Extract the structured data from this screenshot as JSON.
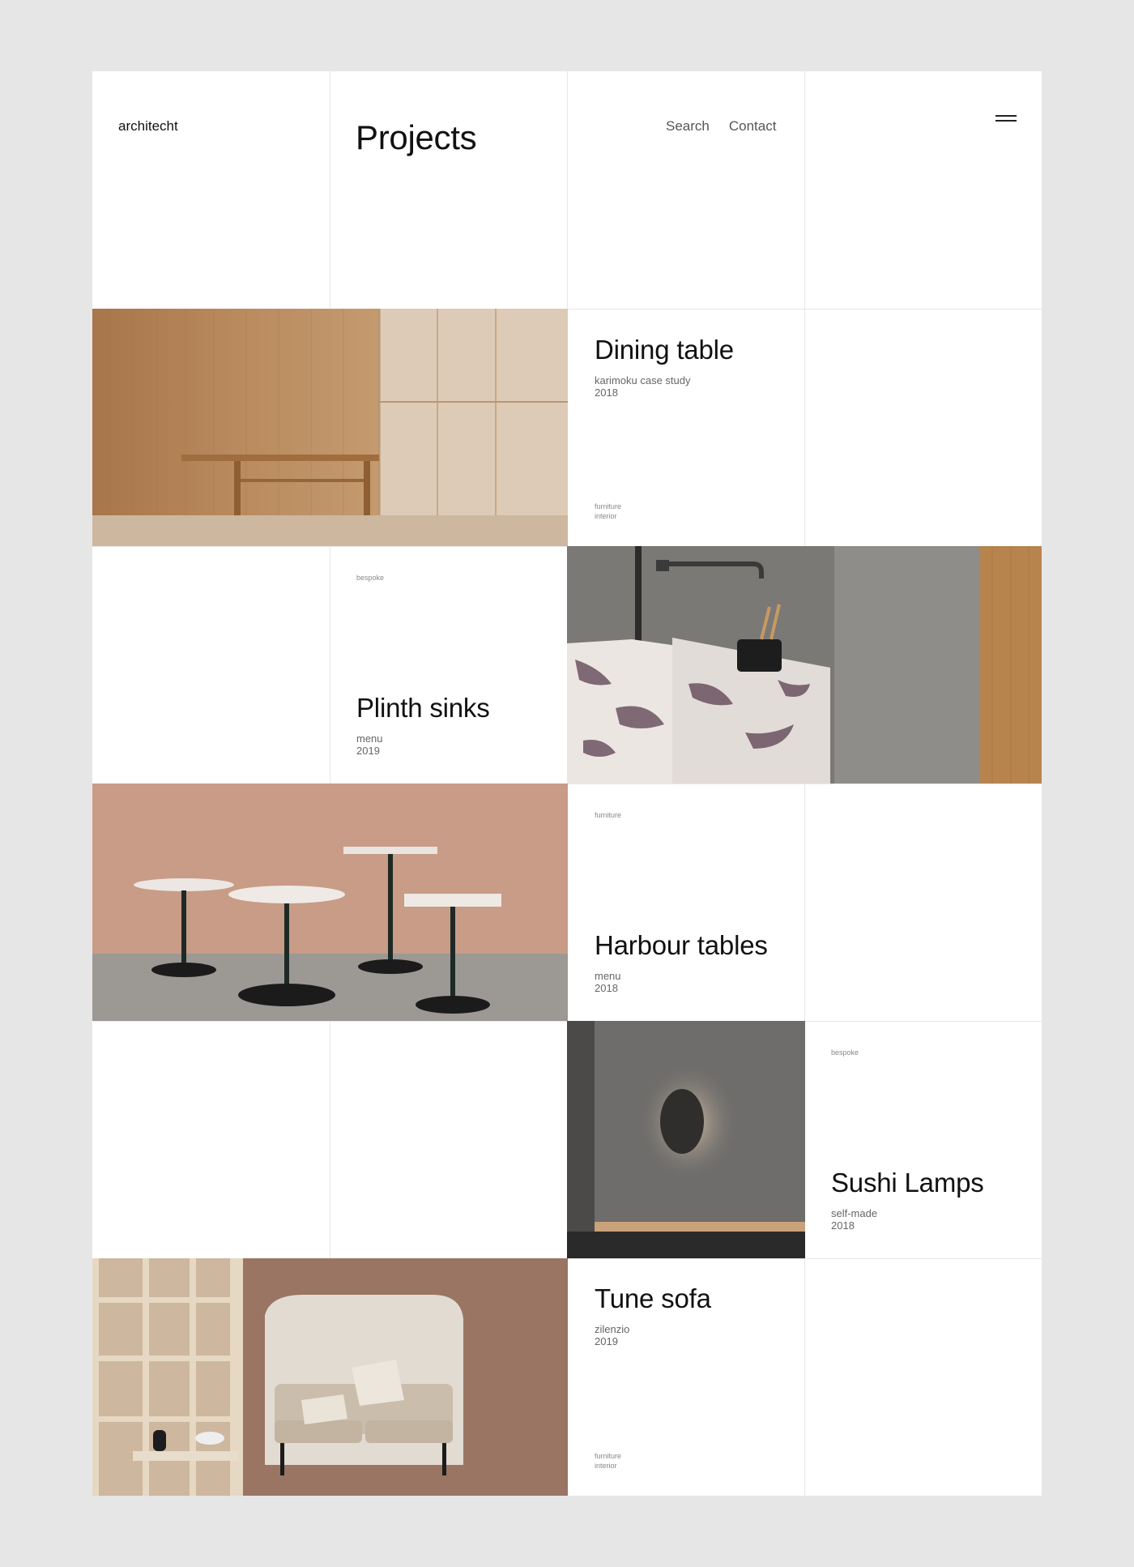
{
  "header": {
    "logo": "architecht",
    "title": "Projects",
    "nav": {
      "search": "Search",
      "contact": "Contact"
    },
    "menu_icon": "hamburger-menu-icon"
  },
  "projects": [
    {
      "title": "Dining table",
      "meta1": "karimoku case study",
      "year": "2018",
      "tag1": "furniture",
      "tag2": "interior"
    },
    {
      "title": "Plinth sinks",
      "meta1": "menu",
      "year": "2019",
      "tag1": "bespoke"
    },
    {
      "title": "Harbour tables",
      "meta1": "menu",
      "year": "2018",
      "tag1": "furniture"
    },
    {
      "title": "Sushi Lamps",
      "meta1": "self-made",
      "year": "2018",
      "tag1": "bespoke"
    },
    {
      "title": "Tune sofa",
      "meta1": "zilenzio",
      "year": "2019",
      "tag1": "furniture",
      "tag2": "interior"
    }
  ],
  "colors": {
    "background": "#e6e6e6",
    "panel": "#ffffff",
    "grid": "#e7e7e7",
    "text": "#111111",
    "muted": "#666666"
  }
}
